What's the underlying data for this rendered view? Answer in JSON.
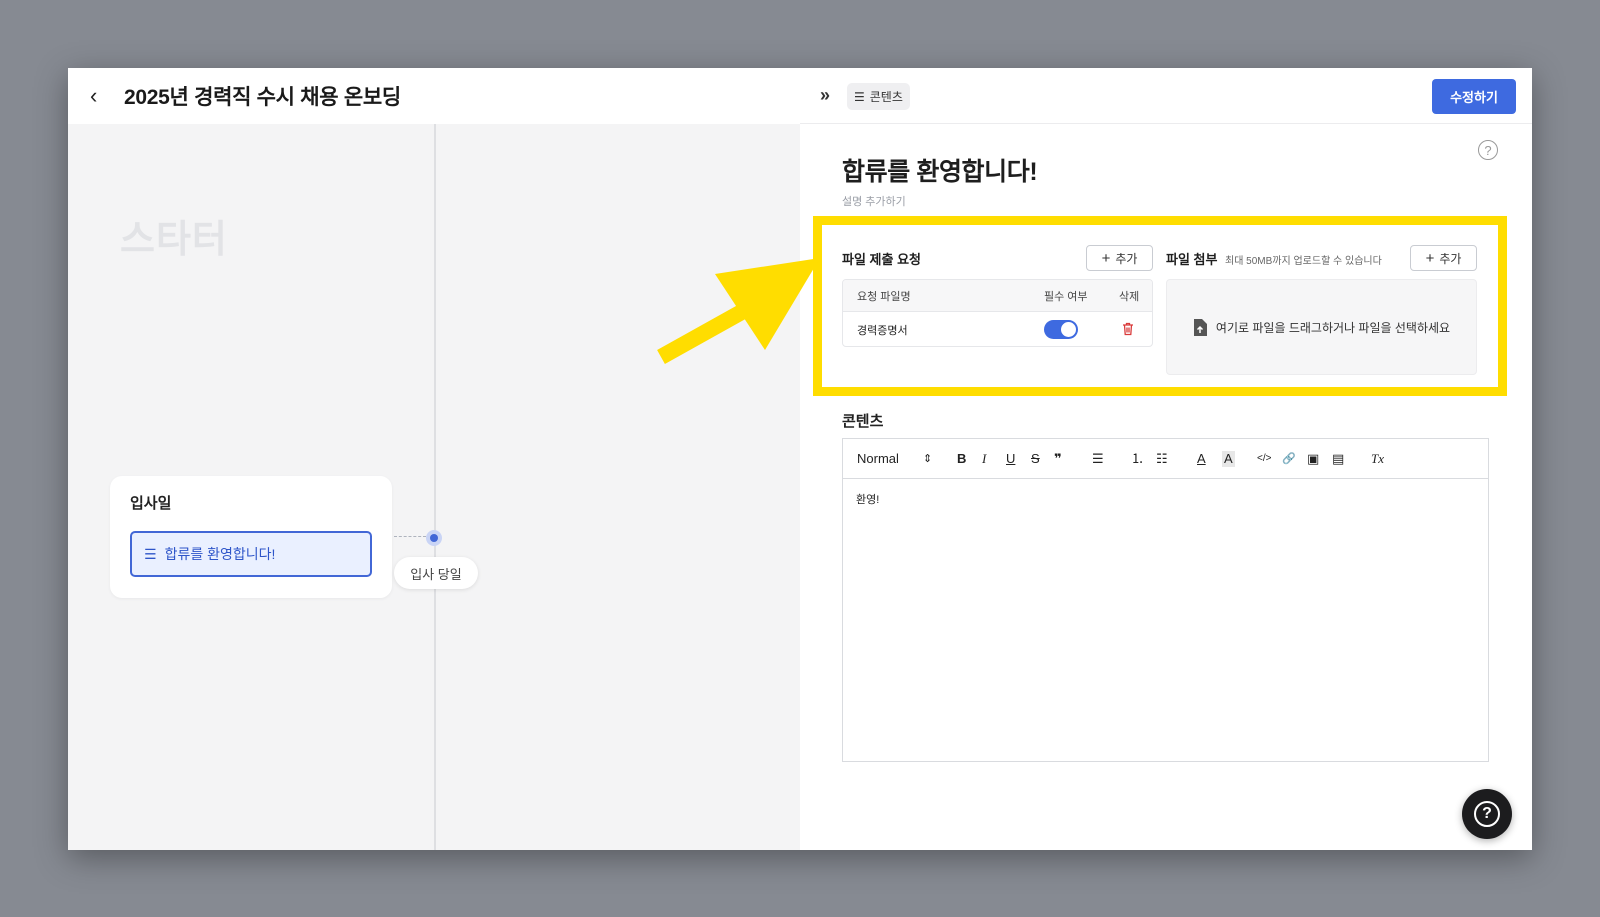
{
  "header": {
    "back_icon": "chevron-left-icon",
    "back_glyph": "‹",
    "title": "2025년 경력직 수시 채용 온보딩"
  },
  "timeline": {
    "stage_label": "스타터",
    "day_card": {
      "title": "입사일",
      "item_label": "합류를 환영합니다!",
      "item_icon": "list-icon"
    },
    "day_pill": "입사 당일"
  },
  "panel": {
    "collapse_glyph": "»",
    "tab_label": "콘텐츠",
    "edit_button": "수정하기",
    "help_glyph": "?",
    "title": "합류를 환영합니다!",
    "add_description": "설명 추가하기",
    "file_request": {
      "title": "파일 제출 요청",
      "add_label": "추가",
      "columns": {
        "name": "요청 파일명",
        "required": "필수 여부",
        "delete": "삭제"
      },
      "rows": [
        {
          "name": "경력증명서",
          "required": true
        }
      ]
    },
    "file_attach": {
      "title": "파일 첨부",
      "note": "최대 50MB까지 업로드할 수 있습니다",
      "add_label": "추가",
      "dropzone_text": "여기로 파일을 드래그하거나 파일을 선택하세요"
    },
    "content_section_title": "콘텐츠",
    "editor": {
      "format_select": "Normal",
      "toolbar": {
        "bold": "B",
        "italic": "I",
        "underline": "U",
        "strike": "S",
        "quote": "❞",
        "align": "☰",
        "ordered_list": "⒈",
        "bullet_list": "☷",
        "font_color": "A",
        "highlight": "A",
        "code": "</>",
        "link": "🔗",
        "image": "▣",
        "video": "▤",
        "clear": "Tx"
      },
      "body_text": "환영!"
    }
  },
  "colors": {
    "accent": "#3e6ae0",
    "highlight_annotation": "#ffdd00",
    "delete": "#d93a3a"
  }
}
